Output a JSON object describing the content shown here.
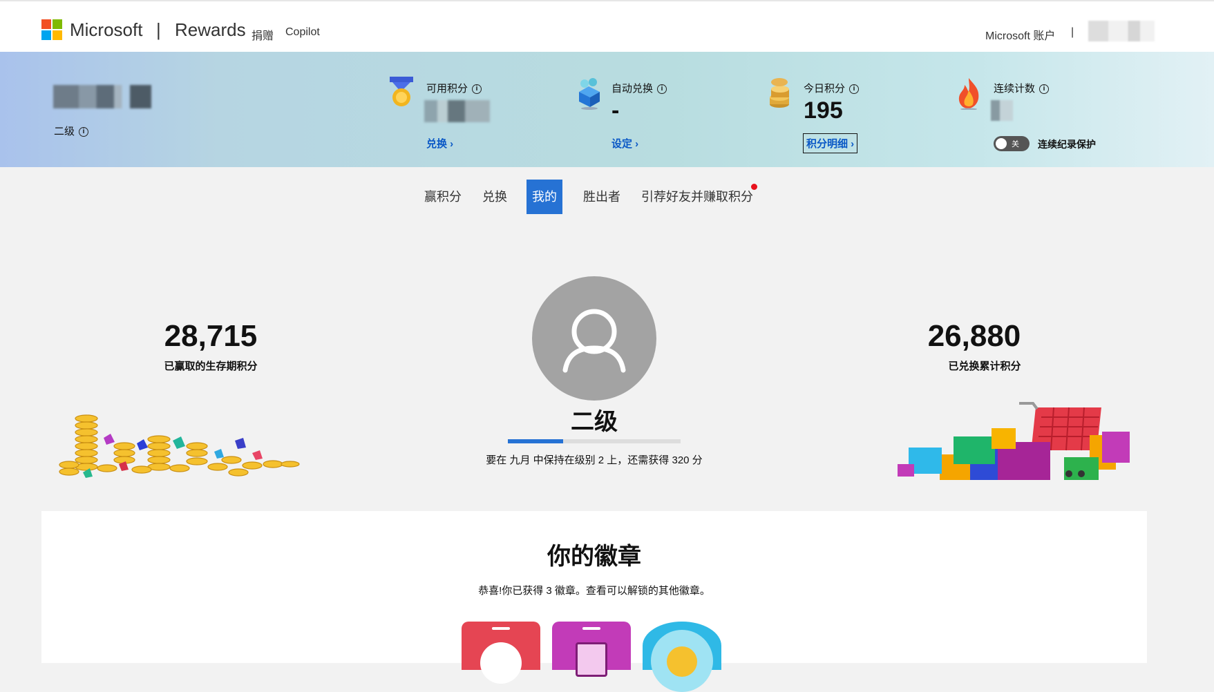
{
  "header": {
    "brand": "Microsoft",
    "separator": "|",
    "product": "Rewards",
    "nav": [
      "捐赠",
      "Copilot"
    ],
    "account_label": "Microsoft 账户",
    "account_separator": "|"
  },
  "banner": {
    "level_label": "二级",
    "available_points": {
      "label": "可用积分",
      "link": "兑换 ›"
    },
    "auto_redeem": {
      "label": "自动兑换",
      "value": "-",
      "link": "设定 ›"
    },
    "today_points": {
      "label": "今日积分",
      "value": "195",
      "link": "积分明细 ›"
    },
    "streak": {
      "label": "连续计数",
      "toggle_state": "关",
      "toggle_label": "连续纪录保护"
    }
  },
  "tabs": {
    "items": [
      "赢积分",
      "兑换",
      "我的",
      "胜出者",
      "引荐好友并赚取积分"
    ],
    "active": "我的"
  },
  "summary": {
    "lifetime_points": "28,715",
    "lifetime_label": "已赢取的生存期积分",
    "redeemed_points": "26,880",
    "redeemed_label": "已兑换累计积分",
    "level": "二级",
    "level_progress": 0.32,
    "level_note": "要在 九月 中保持在级别 2 上，还需获得 320 分"
  },
  "badges": {
    "title": "你的徽章",
    "subtitle": "恭喜!你已获得 3 徽章。查看可以解锁的其他徽章。",
    "colors": [
      "#e54553",
      "#c23bb8",
      "#2fb9e6"
    ]
  }
}
